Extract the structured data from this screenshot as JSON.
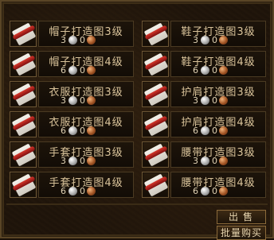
{
  "items": [
    {
      "name": "帽子打造图3级",
      "qty_a": "3",
      "qty_b": "0"
    },
    {
      "name": "鞋子打造图3级",
      "qty_a": "3",
      "qty_b": "0"
    },
    {
      "name": "帽子打造图4级",
      "qty_a": "6",
      "qty_b": "0"
    },
    {
      "name": "鞋子打造图4级",
      "qty_a": "6",
      "qty_b": "0"
    },
    {
      "name": "衣服打造图3级",
      "qty_a": "3",
      "qty_b": "0"
    },
    {
      "name": "护肩打造图3级",
      "qty_a": "3",
      "qty_b": "0"
    },
    {
      "name": "衣服打造图4级",
      "qty_a": "6",
      "qty_b": "0"
    },
    {
      "name": "护肩打造图4级",
      "qty_a": "6",
      "qty_b": "0"
    },
    {
      "name": "手套打造图3级",
      "qty_a": "3",
      "qty_b": "0"
    },
    {
      "name": "腰带打造图3级",
      "qty_a": "3",
      "qty_b": "0"
    },
    {
      "name": "手套打造图4级",
      "qty_a": "6",
      "qty_b": "0"
    },
    {
      "name": "腰带打造图4级",
      "qty_a": "6",
      "qty_b": "0"
    }
  ],
  "buttons": {
    "sell": "出售",
    "bulk_buy": "批量购买"
  },
  "icons": {
    "item": "scroll-icon",
    "currency_a": "silver-coin-icon",
    "currency_b": "copper-coin-icon"
  }
}
